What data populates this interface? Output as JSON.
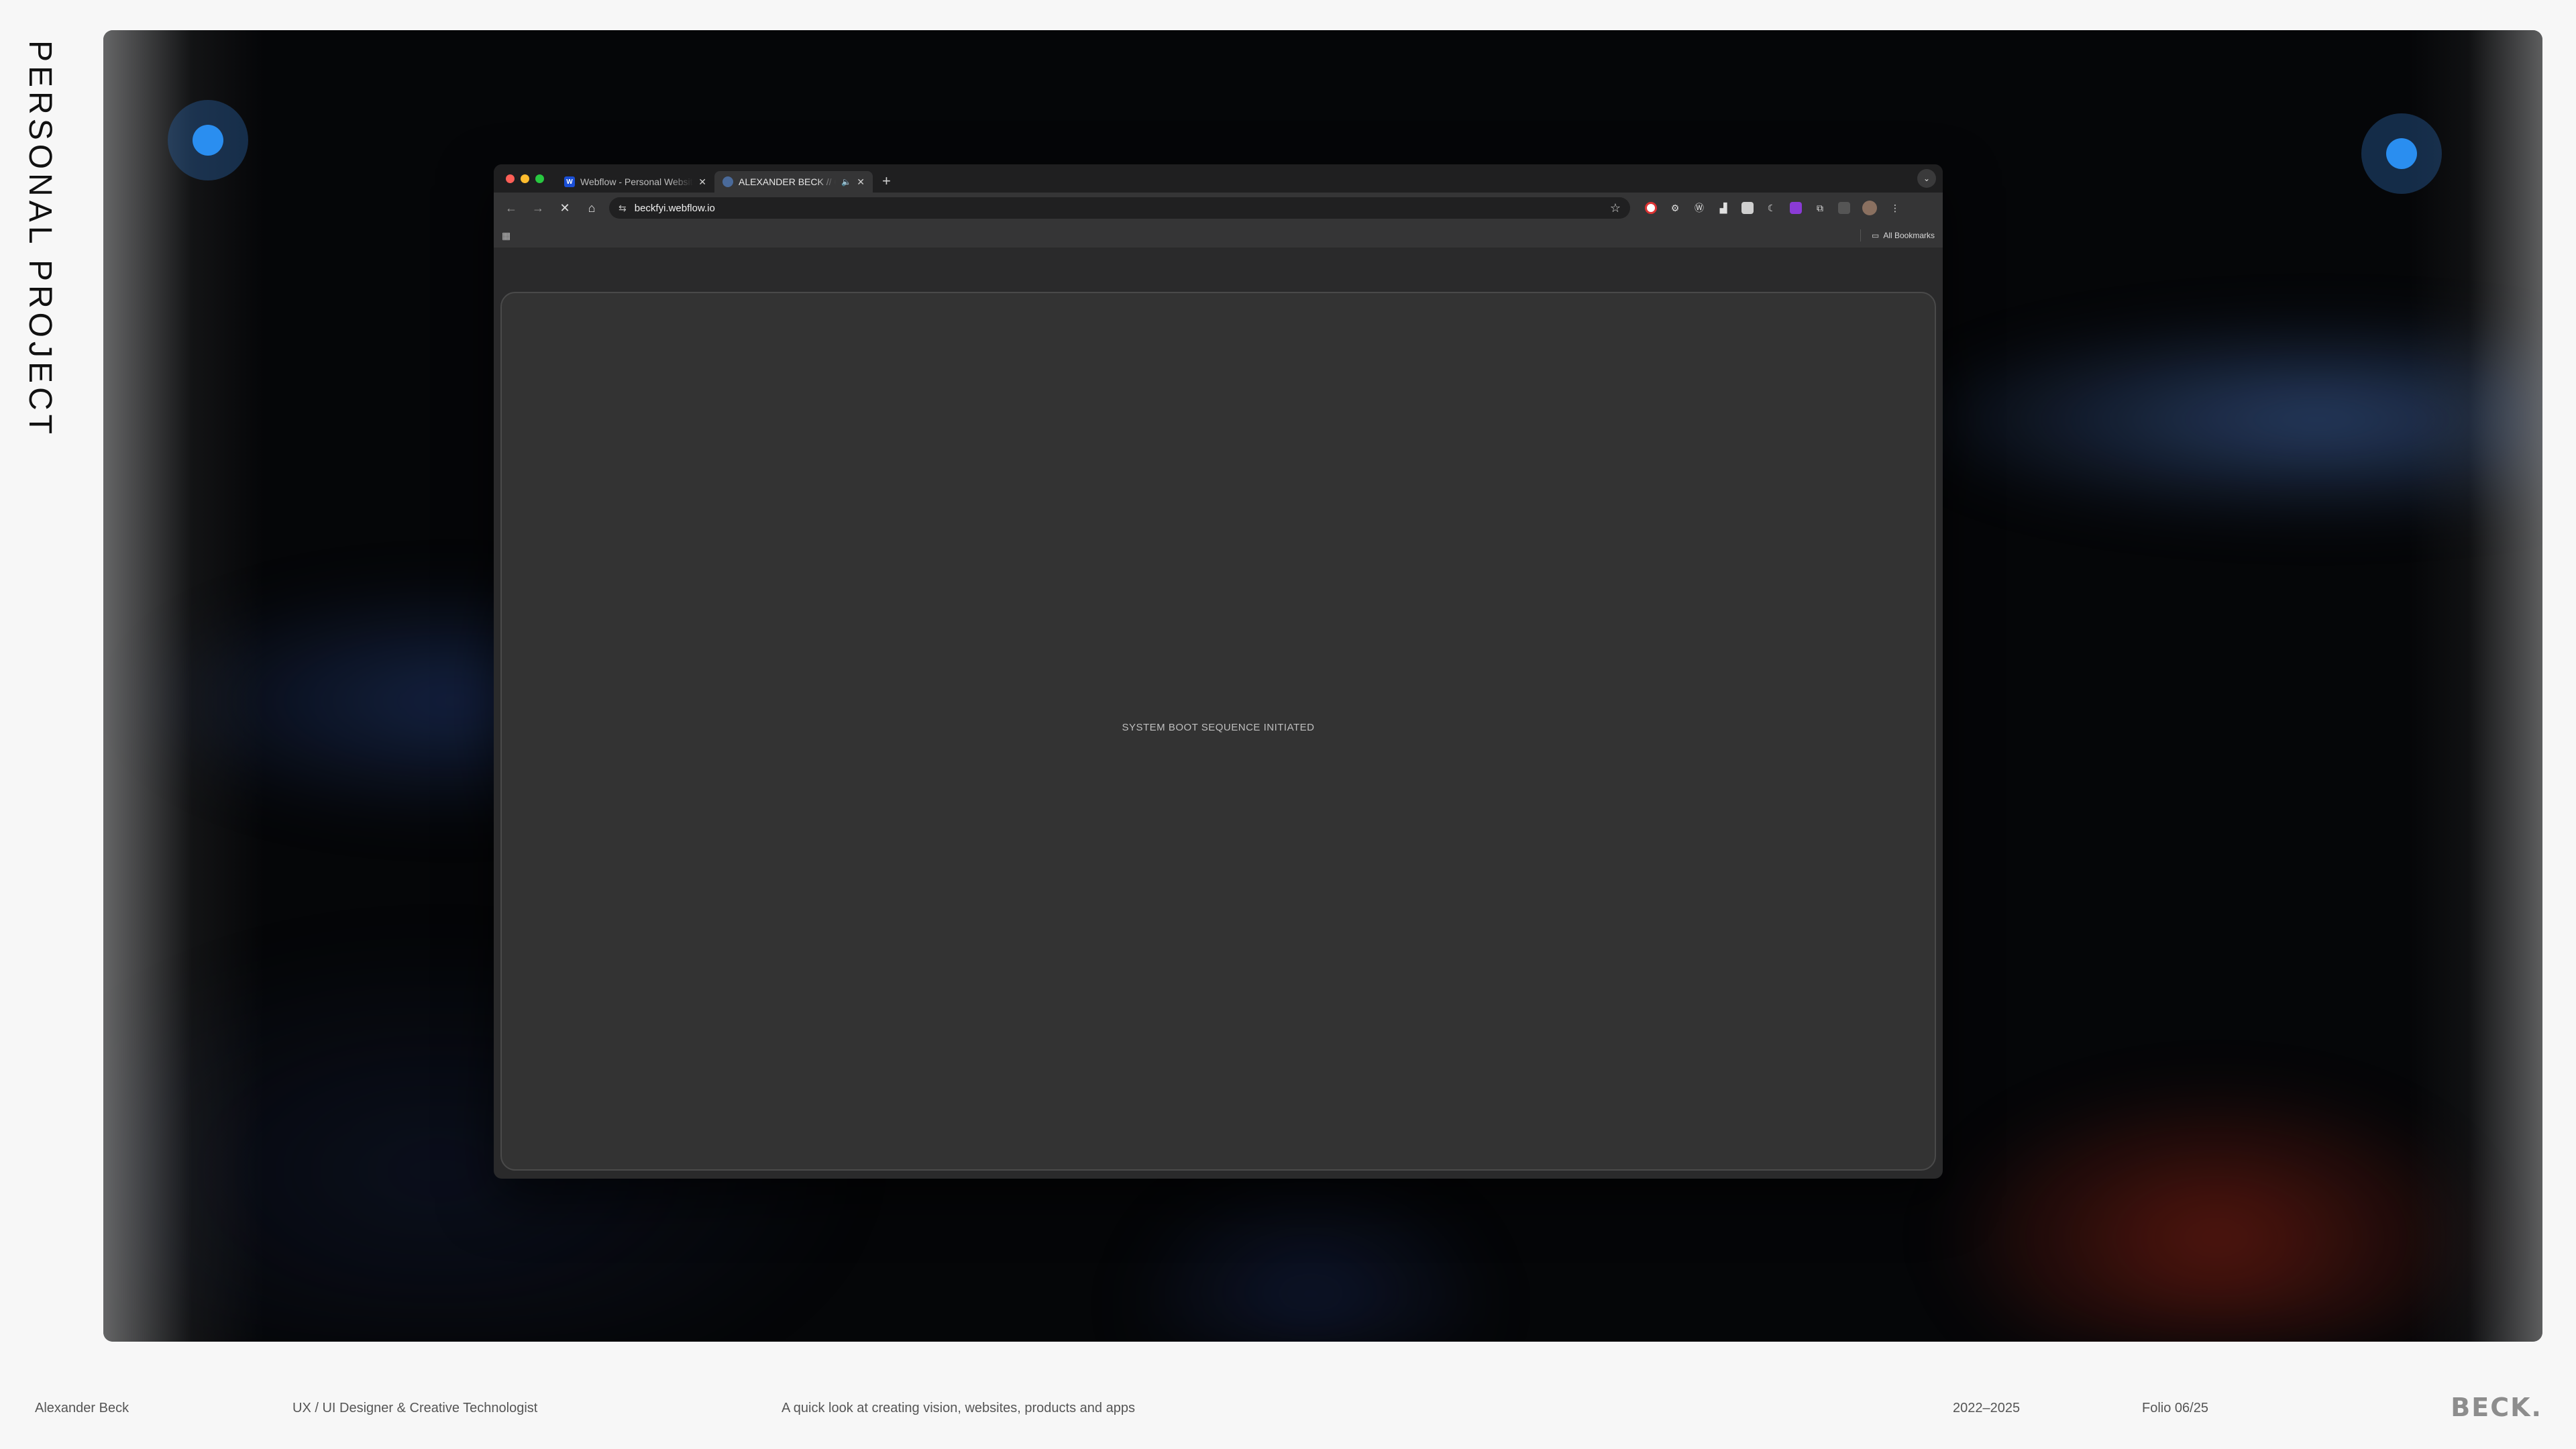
{
  "page": {
    "side_title": "PERSONAL PROJECT",
    "accent_dot_color": "#2a8ef0"
  },
  "browser": {
    "tabs": [
      {
        "title": "Webflow - Personal Website",
        "favicon": "webflow-favicon",
        "active": false
      },
      {
        "title": "ALEXANDER BECK // Co",
        "favicon": "site-favicon",
        "active": true,
        "audio": true
      }
    ],
    "new_tab": "+",
    "address": {
      "url": "beckfyi.webflow.io"
    },
    "bookmarks": {
      "all_label": "All Bookmarks"
    },
    "content": {
      "status_text": "SYSTEM BOOT SEQUENCE INITIATED"
    }
  },
  "footer": {
    "name": "Alexander Beck",
    "role": "UX / UI Designer & Creative Technologist",
    "tagline": "A quick look at creating vision, websites, products and apps",
    "years": "2022–2025",
    "folio": "Folio 06/25",
    "logo": "BECK."
  }
}
